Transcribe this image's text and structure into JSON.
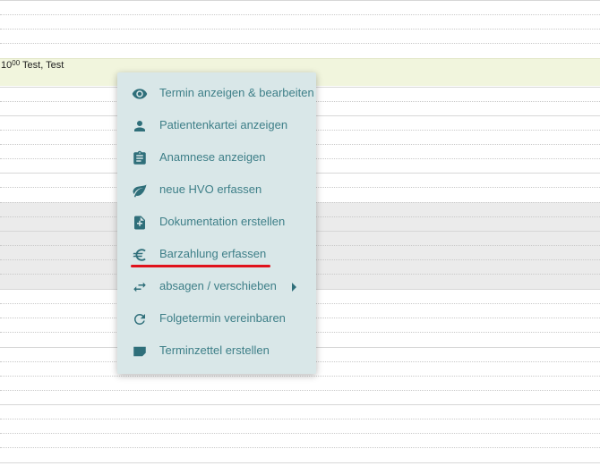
{
  "appointment": {
    "hour": "10",
    "minutes": "00",
    "name": "Test, Test"
  },
  "context_menu": {
    "items": [
      {
        "label": "Termin anzeigen & bearbeiten",
        "icon": "eye-icon"
      },
      {
        "label": "Patientenkartei anzeigen",
        "icon": "person-icon"
      },
      {
        "label": "Anamnese anzeigen",
        "icon": "clipboard-icon"
      },
      {
        "label": "neue HVO erfassen",
        "icon": "leaf-icon"
      },
      {
        "label": "Dokumentation erstellen",
        "icon": "file-plus-icon"
      },
      {
        "label": "Barzahlung erfassen",
        "icon": "euro-icon"
      },
      {
        "label": "absagen / verschieben",
        "icon": "swap-arrows-icon",
        "has_submenu": true
      },
      {
        "label": "Folgetermin vereinbaren",
        "icon": "refresh-icon"
      },
      {
        "label": "Terminzettel erstellen",
        "icon": "ticket-icon"
      }
    ]
  },
  "colors": {
    "menu_background": "#d9e7e8",
    "menu_text": "#3e7f88",
    "menu_icon": "#2f6f7a",
    "appointment_background": "#f1f5dd",
    "highlight_underline": "#e0121b"
  }
}
